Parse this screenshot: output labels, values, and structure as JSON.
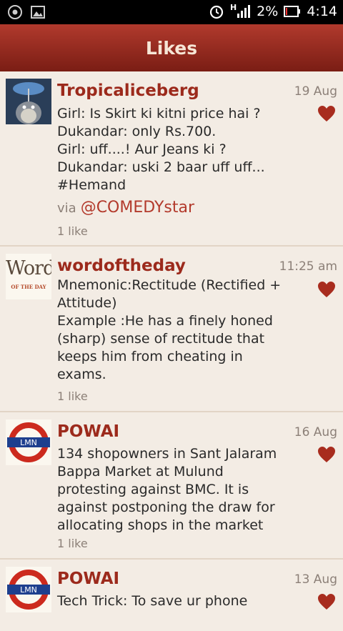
{
  "status": {
    "battery": "2%",
    "time": "4:14",
    "signal": "H"
  },
  "header": {
    "title": "Likes"
  },
  "posts": [
    {
      "user": "Tropicaliceberg",
      "time": "19 Aug",
      "lines": [
        "Girl: Is Skirt ki kitni price hai ?",
        "Dukandar: only Rs.700.",
        "Girl: uff....! Aur Jeans ki ?",
        "Dukandar: uski 2 baar uff uff...",
        "#Hemand"
      ],
      "via_label": "via",
      "via_handle": "@COMEDYstar",
      "likes": "1 like"
    },
    {
      "user": "wordoftheday",
      "time": "11:25 am",
      "lines": [
        "Mnemonic:Rectitude (Rectified +",
        "Attitude)",
        "Example :He has a finely honed",
        "(sharp) sense of rectitude that",
        "keeps him from cheating in",
        "exams."
      ],
      "likes": "1 like",
      "avatar_text": [
        "Word",
        "OF THE DAY"
      ]
    },
    {
      "user": "POWAI",
      "time": "16 Aug",
      "lines": [
        "134 shopowners in Sant Jalaram",
        "Bappa Market at Mulund",
        "protesting against BMC. It is",
        "against postponing the draw for",
        "allocating shops in the market"
      ],
      "likes": "1 like",
      "avatar_text": [
        "LMN"
      ]
    },
    {
      "user": "POWAI",
      "time": "13 Aug",
      "lines": [
        "Tech Trick: To save ur phone"
      ],
      "avatar_text": [
        "LMN"
      ]
    }
  ]
}
